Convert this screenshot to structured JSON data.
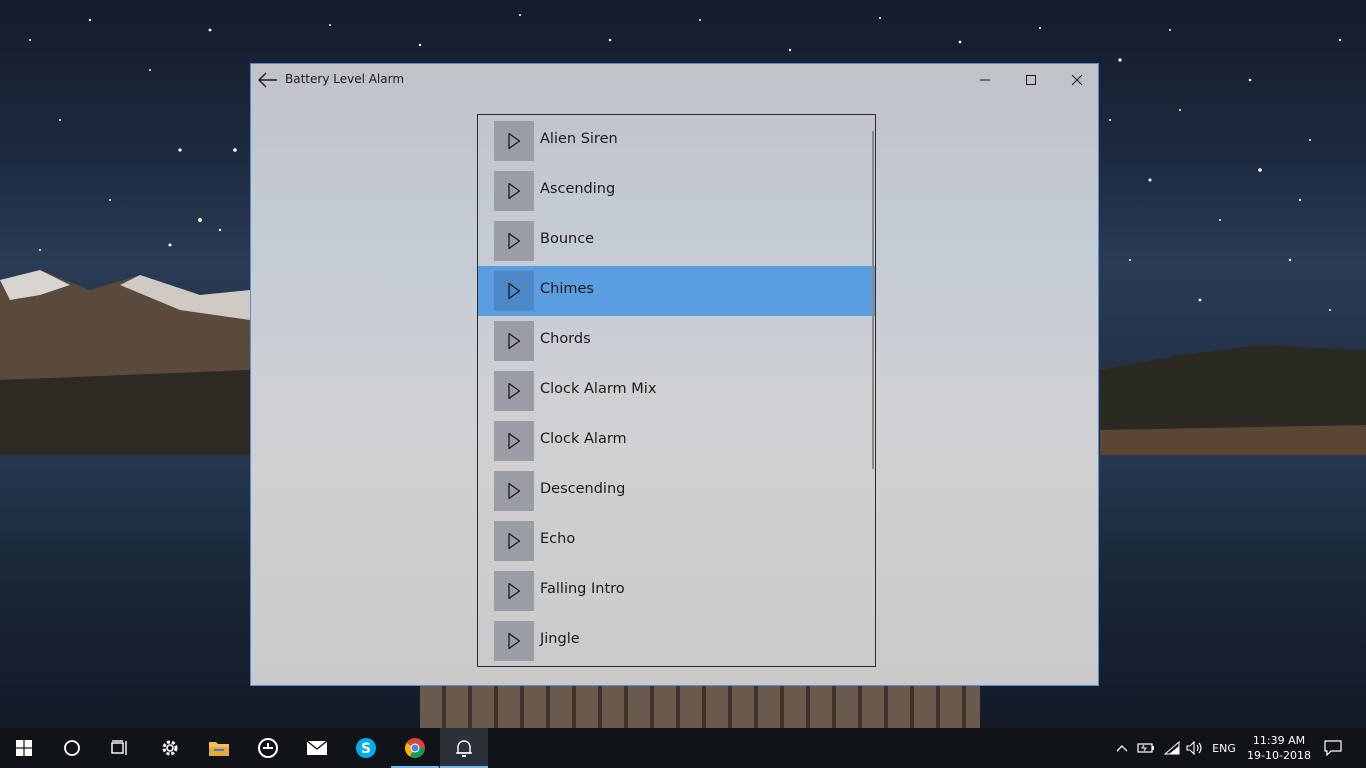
{
  "window": {
    "title": "Battery Level Alarm"
  },
  "sounds": [
    {
      "label": "Alien Siren",
      "selected": false
    },
    {
      "label": "Ascending",
      "selected": false
    },
    {
      "label": "Bounce",
      "selected": false
    },
    {
      "label": "Chimes",
      "selected": true
    },
    {
      "label": "Chords",
      "selected": false
    },
    {
      "label": "Clock Alarm Mix",
      "selected": false
    },
    {
      "label": "Clock Alarm",
      "selected": false
    },
    {
      "label": "Descending",
      "selected": false
    },
    {
      "label": "Echo",
      "selected": false
    },
    {
      "label": "Falling Intro",
      "selected": false
    },
    {
      "label": "Jingle",
      "selected": false
    }
  ],
  "colors": {
    "selection": "#5a9ee0",
    "play_button": "#9a9da3",
    "window_border": "#4f8fd8",
    "taskbar": "#101418"
  },
  "taskbar": {
    "apps": [
      "start-icon",
      "cortana-icon",
      "task-view-icon",
      "settings-icon",
      "file-explorer-icon",
      "edge-icon",
      "mail-icon",
      "skype-icon",
      "chrome-icon",
      "battery-alarm-icon"
    ],
    "language": "ENG",
    "time": "11:39 AM",
    "date": "19-10-2018"
  }
}
